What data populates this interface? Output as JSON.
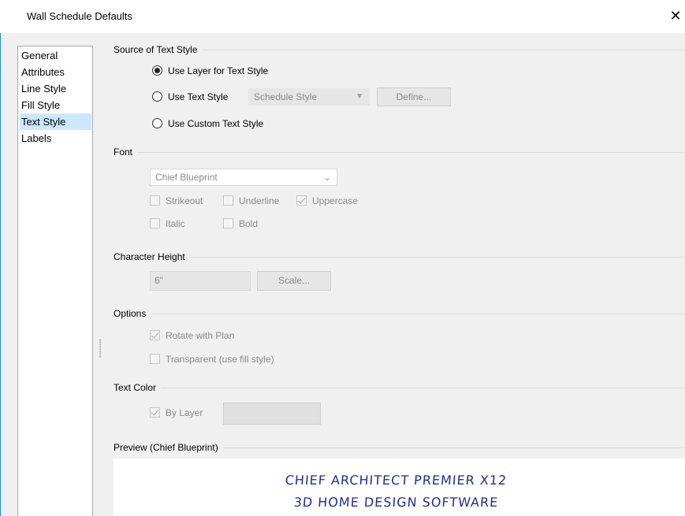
{
  "window": {
    "title": "Wall Schedule Defaults",
    "close_glyph": "✕"
  },
  "sidebar": {
    "items": [
      {
        "label": "General",
        "selected": false
      },
      {
        "label": "Attributes",
        "selected": false
      },
      {
        "label": "Line Style",
        "selected": false
      },
      {
        "label": "Fill Style",
        "selected": false
      },
      {
        "label": "Text Style",
        "selected": true
      },
      {
        "label": "Labels",
        "selected": false
      }
    ]
  },
  "source_of_text_style": {
    "heading": "Source of Text Style",
    "option_layer": "Use Layer for Text Style",
    "option_text_style": "Use Text Style",
    "option_custom": "Use Custom Text Style",
    "selected": "Use Layer for Text Style",
    "text_style_dropdown_value": "Schedule Style",
    "define_button": "Define..."
  },
  "font": {
    "heading": "Font",
    "font_dropdown_value": "Chief Blueprint",
    "strikeout": {
      "label": "Strikeout",
      "checked": false
    },
    "underline": {
      "label": "Underline",
      "checked": false
    },
    "uppercase": {
      "label": "Uppercase",
      "checked": true
    },
    "italic": {
      "label": "Italic",
      "checked": false
    },
    "bold": {
      "label": "Bold",
      "checked": false
    }
  },
  "character_height": {
    "heading": "Character Height",
    "value": "6\"",
    "scale_button": "Scale..."
  },
  "options": {
    "heading": "Options",
    "rotate_with_plan": {
      "label": "Rotate with Plan",
      "checked": true
    },
    "transparent": {
      "label": "Transparent (use fill style)",
      "checked": false
    }
  },
  "text_color": {
    "heading": "Text Color",
    "by_layer": {
      "label": "By Layer",
      "checked": true
    },
    "swatch_color": "#e0e0e0"
  },
  "preview": {
    "heading": "Preview (Chief Blueprint)",
    "line1": "CHIEF ARCHITECT PREMIER X12",
    "line2": "3D HOME DESIGN SOFTWARE",
    "text_color": "#1f2f8f"
  },
  "colors": {
    "selection": "#cce8ff",
    "window_border": "#1c8ed9",
    "dialog_background": "#f0f0f0"
  }
}
